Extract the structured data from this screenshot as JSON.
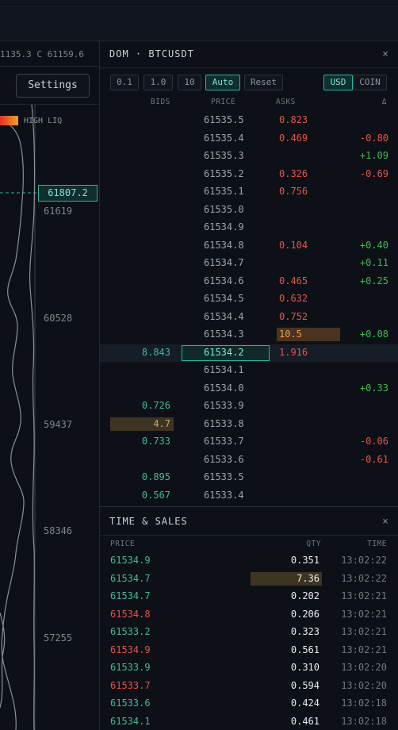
{
  "chart": {
    "ohlc_text": "1135.3  C 61159.6",
    "settings_label": "Settings",
    "liq_label": "HIGH LIQ",
    "current_price_tag": "61807.2",
    "axis_labels": [
      "61619",
      "60528",
      "59437",
      "58346",
      "57255"
    ]
  },
  "dom": {
    "title": "DOM · BTCUSDT",
    "close_icon": "×",
    "tick_buttons": [
      "0.1",
      "1.0",
      "10",
      "Auto"
    ],
    "active_tick": "Auto",
    "reset_label": "Reset",
    "unit_buttons": [
      "USD",
      "COIN"
    ],
    "active_unit": "USD",
    "headers": {
      "bids": "BIDS",
      "price": "PRICE",
      "asks": "ASKS",
      "delta": "Δ"
    },
    "rows": [
      {
        "bid": "",
        "price": "61535.5",
        "ask": "0.823",
        "delta": ""
      },
      {
        "bid": "",
        "price": "61535.4",
        "ask": "0.469",
        "delta": "-0.80"
      },
      {
        "bid": "",
        "price": "61535.3",
        "ask": "",
        "delta": "+1.09"
      },
      {
        "bid": "",
        "price": "61535.2",
        "ask": "0.326",
        "delta": "-0.69"
      },
      {
        "bid": "",
        "price": "61535.1",
        "ask": "0.756",
        "delta": ""
      },
      {
        "bid": "",
        "price": "61535.0",
        "ask": "",
        "delta": ""
      },
      {
        "bid": "",
        "price": "61534.9",
        "ask": "",
        "delta": ""
      },
      {
        "bid": "",
        "price": "61534.8",
        "ask": "0.104",
        "delta": "+0.40"
      },
      {
        "bid": "",
        "price": "61534.7",
        "ask": "",
        "delta": "+0.11"
      },
      {
        "bid": "",
        "price": "61534.6",
        "ask": "0.465",
        "delta": "+0.25"
      },
      {
        "bid": "",
        "price": "61534.5",
        "ask": "0.632",
        "delta": ""
      },
      {
        "bid": "",
        "price": "61534.4",
        "ask": "0.752",
        "delta": ""
      },
      {
        "bid": "",
        "price": "61534.3",
        "ask": "10.5",
        "delta": "+0.08"
      },
      {
        "bid": "8.843",
        "price": "61534.2",
        "ask": "1.916",
        "delta": ""
      },
      {
        "bid": "",
        "price": "61534.1",
        "ask": "",
        "delta": ""
      },
      {
        "bid": "",
        "price": "61534.0",
        "ask": "",
        "delta": "+0.33"
      },
      {
        "bid": "0.726",
        "price": "61533.9",
        "ask": "",
        "delta": ""
      },
      {
        "bid": "4.7",
        "price": "61533.8",
        "ask": "",
        "delta": ""
      },
      {
        "bid": "0.733",
        "price": "61533.7",
        "ask": "",
        "delta": "-0.06"
      },
      {
        "bid": "",
        "price": "61533.6",
        "ask": "",
        "delta": "-0.61"
      },
      {
        "bid": "0.895",
        "price": "61533.5",
        "ask": "",
        "delta": ""
      },
      {
        "bid": "0.567",
        "price": "61533.4",
        "ask": "",
        "delta": ""
      }
    ],
    "current_price": "61534.2",
    "large_ask": "10.5",
    "large_bid": "4.7"
  },
  "time_sales": {
    "title": "TIME & SALES",
    "close_icon": "×",
    "headers": {
      "price": "PRICE",
      "qty": "QTY",
      "time": "TIME"
    },
    "rows": [
      {
        "price": "61534.9",
        "qty": "0.351",
        "time": "13:02:22",
        "side": "buy"
      },
      {
        "price": "61534.7",
        "qty": "7.36",
        "time": "13:02:22",
        "side": "buy"
      },
      {
        "price": "61534.7",
        "qty": "0.202",
        "time": "13:02:21",
        "side": "buy"
      },
      {
        "price": "61534.8",
        "qty": "0.206",
        "time": "13:02:21",
        "side": "sell"
      },
      {
        "price": "61533.2",
        "qty": "0.323",
        "time": "13:02:21",
        "side": "buy"
      },
      {
        "price": "61534.9",
        "qty": "0.561",
        "time": "13:02:21",
        "side": "sell"
      },
      {
        "price": "61533.9",
        "qty": "0.310",
        "time": "13:02:20",
        "side": "buy"
      },
      {
        "price": "61533.7",
        "qty": "0.594",
        "time": "13:02:20",
        "side": "sell"
      },
      {
        "price": "61533.6",
        "qty": "0.424",
        "time": "13:02:18",
        "side": "buy"
      },
      {
        "price": "61534.1",
        "qty": "0.461",
        "time": "13:02:18",
        "side": "buy"
      }
    ],
    "large_qty": "7.36"
  },
  "colors": {
    "buy": "#3fb9a2",
    "sell": "#e5534b",
    "accent": "#2bb3a0"
  }
}
